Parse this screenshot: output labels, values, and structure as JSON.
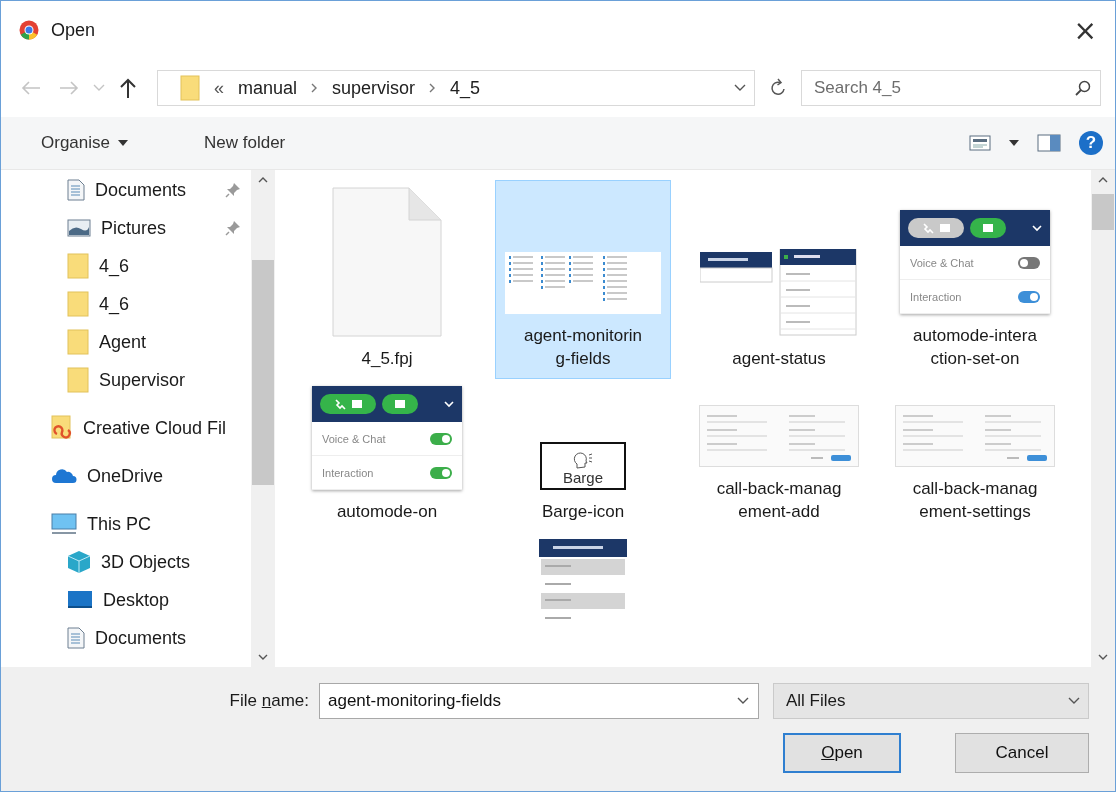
{
  "window": {
    "title": "Open",
    "close_glyph": "×"
  },
  "nav": {
    "back_enabled": false,
    "forward_enabled": false,
    "overflow_glyph": "«",
    "path": [
      "manual",
      "supervisor",
      "4_5"
    ]
  },
  "search": {
    "placeholder": "Search 4_5"
  },
  "toolbar": {
    "organise": "Organise",
    "new_folder": "New folder",
    "help_glyph": "?"
  },
  "sidebar": {
    "quick_access": [
      {
        "label": "Documents",
        "kind": "documents",
        "pinned": true
      },
      {
        "label": "Pictures",
        "kind": "pictures",
        "pinned": true
      },
      {
        "label": "4_6",
        "kind": "folder",
        "pinned": false
      },
      {
        "label": "4_6",
        "kind": "folder",
        "pinned": false
      },
      {
        "label": "Agent",
        "kind": "folder",
        "pinned": false
      },
      {
        "label": "Supervisor",
        "kind": "folder",
        "pinned": false
      }
    ],
    "places": [
      {
        "label": "Creative Cloud Fil",
        "kind": "creative-cloud"
      },
      {
        "label": "OneDrive",
        "kind": "cloud"
      },
      {
        "label": "This PC",
        "kind": "pc",
        "children": [
          {
            "label": "3D Objects",
            "kind": "cube"
          },
          {
            "label": "Desktop",
            "kind": "desktop"
          },
          {
            "label": "Documents",
            "kind": "documents"
          }
        ]
      }
    ]
  },
  "files": [
    {
      "name_lines": [
        "4_5.fpj"
      ],
      "selected": false,
      "thumb": {
        "kind": "blank-file"
      }
    },
    {
      "name_lines": [
        "agent-monitorin",
        "g-fields"
      ],
      "selected": true,
      "thumb": {
        "kind": "table-screenshot"
      }
    },
    {
      "name_lines": [
        "agent-status"
      ],
      "selected": false,
      "thumb": {
        "kind": "menu-screenshot"
      }
    },
    {
      "name_lines": [
        "automode-intera",
        "ction-set-on"
      ],
      "selected": false,
      "thumb": {
        "kind": "toggle-panel",
        "voice_button_active": false,
        "rows": [
          {
            "label": "Voice & Chat",
            "on": false
          },
          {
            "label": "Interaction",
            "on": true,
            "color": "#3d8fd8"
          }
        ]
      }
    },
    {
      "name_lines": [
        "automode-on"
      ],
      "selected": false,
      "thumb": {
        "kind": "toggle-panel",
        "voice_button_active": true,
        "rows": [
          {
            "label": "Voice & Chat",
            "on": true,
            "color": "#3cae4a"
          },
          {
            "label": "Interaction",
            "on": true,
            "color": "#3cae4a"
          }
        ]
      }
    },
    {
      "name_lines": [
        "Barge-icon"
      ],
      "selected": false,
      "thumb": {
        "kind": "icon-preview",
        "caption": "Barge"
      }
    },
    {
      "name_lines": [
        "call-back-manag",
        "ement-add"
      ],
      "selected": false,
      "thumb": {
        "kind": "dialog-screenshot"
      }
    },
    {
      "name_lines": [
        "call-back-manag",
        "ement-settings"
      ],
      "selected": false,
      "thumb": {
        "kind": "dialog-screenshot"
      }
    },
    {
      "selected": false,
      "thumb": {
        "kind": "dropdown-screenshot"
      }
    }
  ],
  "file_name": {
    "label": {
      "before": "File ",
      "key": "n",
      "after": "ame:"
    },
    "value": "agent-monitoring-fields"
  },
  "file_type": {
    "value": "All Files"
  },
  "buttons": [
    {
      "label": {
        "key": "O",
        "after": "pen"
      },
      "default": true
    },
    {
      "label": {
        "before": "Cancel"
      },
      "default": false
    }
  ]
}
